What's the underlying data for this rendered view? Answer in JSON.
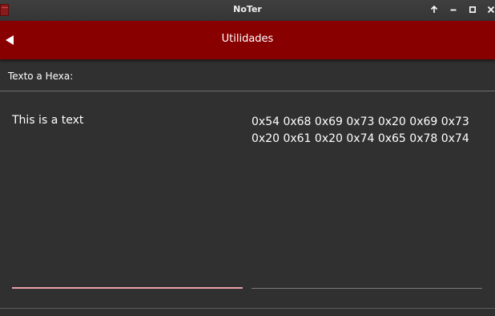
{
  "window": {
    "title": "NoTer",
    "controls": [
      "keep-above-icon",
      "minimize-icon",
      "maximize-icon",
      "close-icon"
    ]
  },
  "toolbar": {
    "back_icon": "back-arrow-icon",
    "title": "Utilidades",
    "color": "#890000"
  },
  "section": {
    "label": "Texto a Hexa:"
  },
  "converter": {
    "input_text": "This is a text",
    "hex_output": "0x54 0x68 0x69 0x73 0x20 0x69 0x73 0x20 0x61 0x20 0x74 0x65 0x78 0x74",
    "active_underline_color": "#e8a0a6"
  }
}
